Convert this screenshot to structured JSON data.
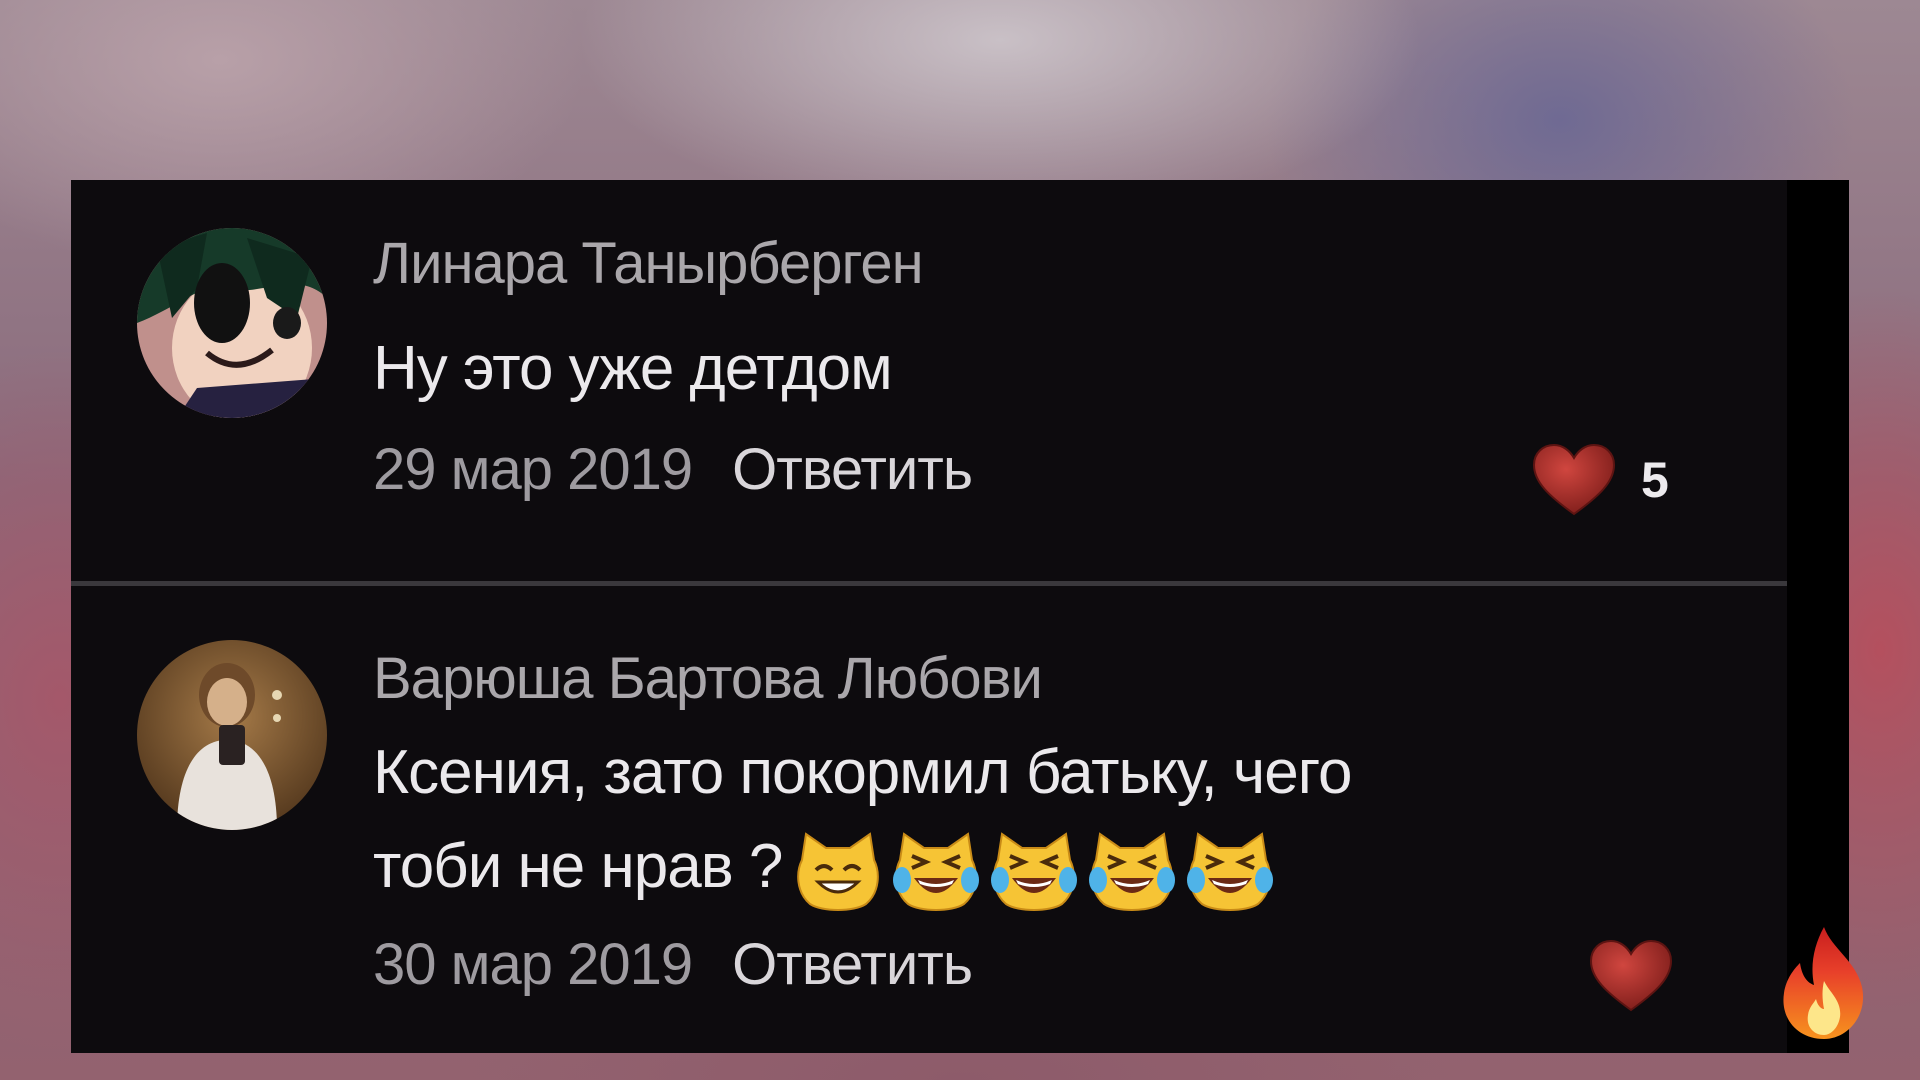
{
  "comments": [
    {
      "author": "Линара Танырберген",
      "text": "Ну это уже детдом",
      "date": "29 мар 2019",
      "reply_label": "Ответить",
      "likes": "5",
      "avatar": "anime-character-avatar"
    },
    {
      "author": "Варюша Бартова Любови",
      "text_line1": "Ксения, зато покормил батьку, чего",
      "text_line2": "тоби не нрав ?",
      "emojis": [
        "smiling-cat-emoji",
        "tears-of-joy-cat-emoji",
        "tears-of-joy-cat-emoji",
        "tears-of-joy-cat-emoji",
        "tears-of-joy-cat-emoji"
      ],
      "date": "30 мар 2019",
      "reply_label": "Ответить",
      "avatar": "selfie-photo-avatar"
    }
  ],
  "icons": {
    "like": "heart-icon",
    "corner": "fire-icon"
  },
  "colors": {
    "card_background": "#0d0b0e",
    "heart": "#b0302b",
    "emoji": "#f6c435"
  }
}
